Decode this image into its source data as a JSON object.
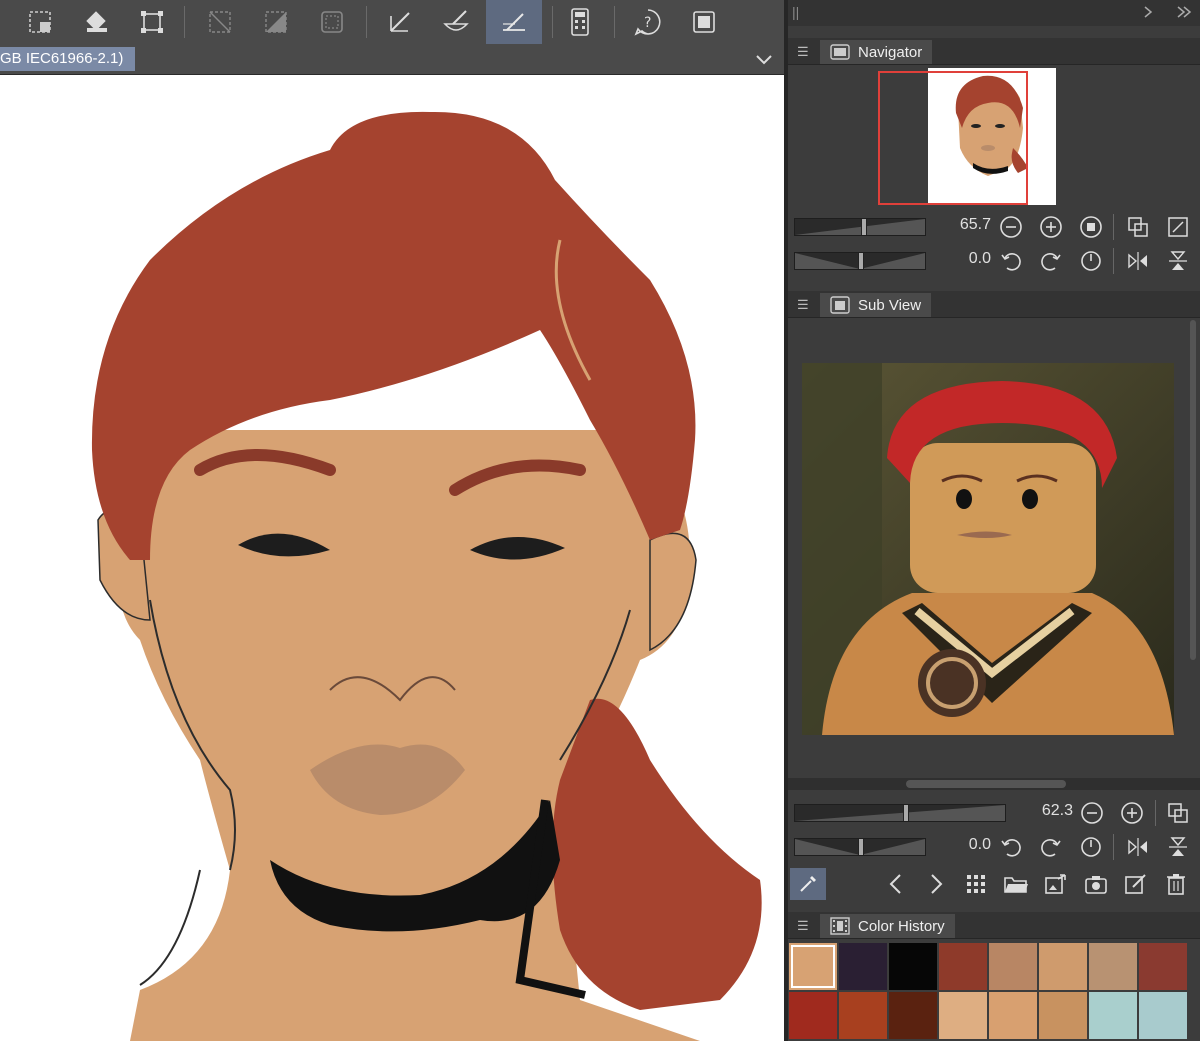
{
  "document": {
    "tab_label": "GB IEC61966-2.1)"
  },
  "toolbar": {
    "icons": [
      "select-all-icon",
      "fill-icon",
      "transform-icon",
      "deselect-icon",
      "invert-selection-icon",
      "selection-border-icon",
      "ruler-line-icon",
      "brush-ruler-icon",
      "perspective-ruler-icon",
      "calculator-icon",
      "help-icon",
      "canvas-window-icon"
    ],
    "active": "perspective-ruler-icon"
  },
  "navigator": {
    "title": "Navigator",
    "zoom": "65.7",
    "rotation": "0.0"
  },
  "subview": {
    "title": "Sub View",
    "zoom": "62.3",
    "rotation": "0.0"
  },
  "color_history": {
    "title": "Color History",
    "colors": [
      "#d7a273",
      "#2a1f33",
      "#060606",
      "#8e3a2a",
      "#b88664",
      "#cf9b6d",
      "#b89272",
      "#8a3a30",
      "#a02a1e",
      "#a8401f",
      "#5a2210",
      "#deae82",
      "#d8a070",
      "#c89260",
      "#a9cfcd",
      "#a8cbcd"
    ],
    "selected_index": 0
  },
  "colors": {
    "accent": "#5e6a80",
    "tab_blue": "#7b8aa6",
    "nav_frame": "#e0403a"
  }
}
